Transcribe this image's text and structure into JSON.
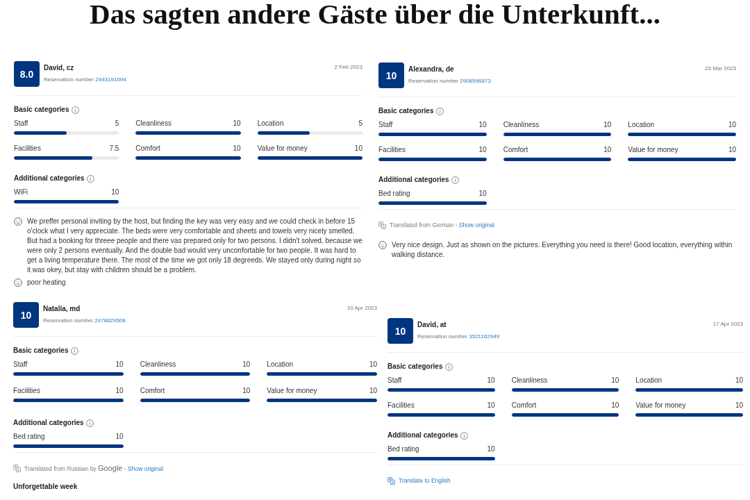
{
  "title": "Das sagten andere Gäste über die Unterkunft...",
  "columns": [
    {
      "reviews": [
        {
          "score": "8.0",
          "name": "David, cz",
          "reservation_label": "Reservation number",
          "reservation_number": "2443191594",
          "date": "2 Feb 2023",
          "basic": {
            "title": "Basic categories",
            "items": [
              {
                "label": "Staff",
                "value": "5",
                "level": 0.5
              },
              {
                "label": "Cleanliness",
                "value": "10",
                "level": 1
              },
              {
                "label": "Location",
                "value": "5",
                "level": 0.5
              },
              {
                "label": "Facilities",
                "value": "7.5",
                "level": 0.75
              },
              {
                "label": "Comfort",
                "value": "10",
                "level": 1
              },
              {
                "label": "Value for money",
                "value": "10",
                "level": 1
              }
            ]
          },
          "additional": {
            "title": "Additional categories",
            "items": [
              {
                "label": "WiFi",
                "value": "10",
                "level": 1
              }
            ]
          },
          "comments": [
            {
              "kind": "positive",
              "text": "We preffer personal inviting by the host, but finding the key was very easy and we could check in before 15 o'clock what I very appreciate. The beds were very comfortable and sheets and towels very nicely smelled. But had a booking for threee people and there vas prepared only for two persons. I didn't solved, because we were only 2 persons eventually. And the double bad would very unconfortable for two people. It was hard to get a living temperature there. The most of the time we got only 18 degreeds. We stayed only during night so it was okey, but stay with children should be a problem."
            },
            {
              "kind": "negative",
              "text": "poor heating"
            }
          ]
        },
        {
          "score": "10",
          "name": "Natalia, md",
          "reservation_label": "Reservation number",
          "reservation_number": "2478829508",
          "date": "10 Apr 2023",
          "basic": {
            "title": "Basic categories",
            "items": [
              {
                "label": "Staff",
                "value": "10",
                "level": 1
              },
              {
                "label": "Cleanliness",
                "value": "10",
                "level": 1
              },
              {
                "label": "Location",
                "value": "10",
                "level": 1
              },
              {
                "label": "Facilities",
                "value": "10",
                "level": 1
              },
              {
                "label": "Comfort",
                "value": "10",
                "level": 1
              },
              {
                "label": "Value for money",
                "value": "10",
                "level": 1
              }
            ]
          },
          "additional": {
            "title": "Additional categories",
            "items": [
              {
                "label": "Bed rating",
                "value": "10",
                "level": 1
              }
            ]
          },
          "translation": {
            "kind": "translated",
            "text": "Translated from Russian by",
            "provider": "Google",
            "separator": "-",
            "link": "Show original"
          },
          "headline": "Unforgettable week"
        }
      ]
    },
    {
      "reviews": [
        {
          "score": "10",
          "name": "Alexandra, de",
          "reservation_label": "Reservation number",
          "reservation_number": "2908596873",
          "date": "23 Mar 2023",
          "basic": {
            "title": "Basic categories",
            "items": [
              {
                "label": "Staff",
                "value": "10",
                "level": 1
              },
              {
                "label": "Cleanliness",
                "value": "10",
                "level": 1
              },
              {
                "label": "Location",
                "value": "10",
                "level": 1
              },
              {
                "label": "Facilities",
                "value": "10",
                "level": 1
              },
              {
                "label": "Comfort",
                "value": "10",
                "level": 1
              },
              {
                "label": "Value for money",
                "value": "10",
                "level": 1
              }
            ]
          },
          "additional": {
            "title": "Additional categories",
            "items": [
              {
                "label": "Bed rating",
                "value": "10",
                "level": 1
              }
            ]
          },
          "translation": {
            "kind": "translated",
            "text": "Translated from German",
            "separator": "-",
            "link": "Show original"
          },
          "comments": [
            {
              "kind": "positive",
              "text": "Very nice design. Just as shown on the pictures. Everything you need is there! Good location, everything within walking distance."
            }
          ]
        },
        {
          "score": "10",
          "name": "David, at",
          "reservation_label": "Reservation number",
          "reservation_number": "3521162949",
          "date": "17 Apr 2023",
          "basic": {
            "title": "Basic categories",
            "items": [
              {
                "label": "Staff",
                "value": "10",
                "level": 1
              },
              {
                "label": "Cleanliness",
                "value": "10",
                "level": 1
              },
              {
                "label": "Location",
                "value": "10",
                "level": 1
              },
              {
                "label": "Facilities",
                "value": "10",
                "level": 1
              },
              {
                "label": "Comfort",
                "value": "10",
                "level": 1
              },
              {
                "label": "Value for money",
                "value": "10",
                "level": 1
              }
            ]
          },
          "additional": {
            "title": "Additional categories",
            "items": [
              {
                "label": "Bed rating",
                "value": "10",
                "level": 1
              }
            ]
          },
          "translation": {
            "kind": "action",
            "link": "Translate to English"
          }
        }
      ]
    }
  ]
}
